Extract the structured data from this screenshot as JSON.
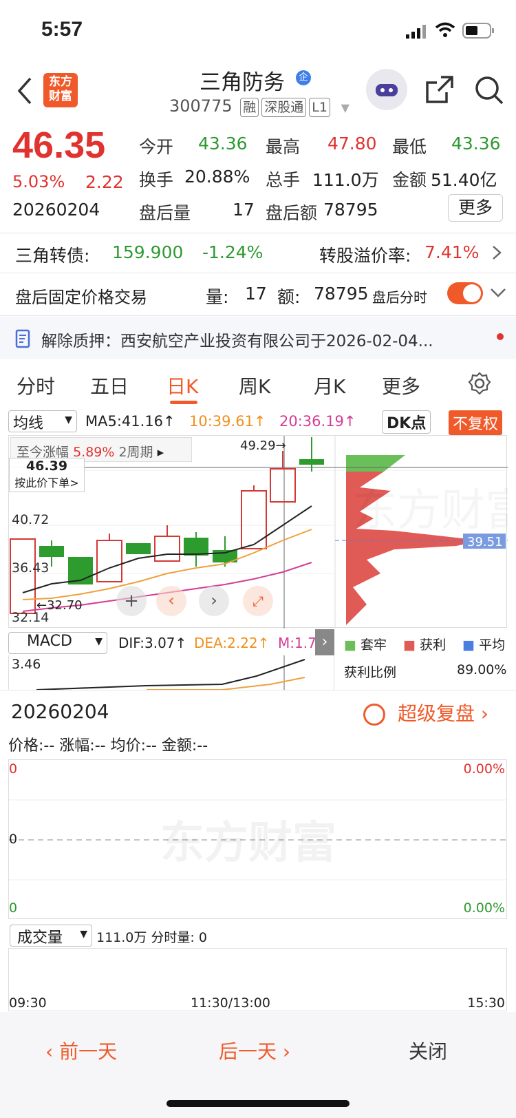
{
  "status": {
    "time": "5:57"
  },
  "header": {
    "logo_text_1": "东方",
    "logo_text_2": "财富",
    "stock_name": "三角防务",
    "badge": "企",
    "code": "300775",
    "tags": [
      "融",
      "深股通",
      "L1"
    ]
  },
  "quote": {
    "price": "46.35",
    "pct": "5.03%",
    "chg": "2.22",
    "date": "20260204",
    "open_label": "今开",
    "open": "43.36",
    "high_label": "最高",
    "high": "47.80",
    "low_label": "最低",
    "low": "43.36",
    "turnover_label": "换手",
    "turnover": "20.88%",
    "vol_label": "总手",
    "vol": "111.0万",
    "amount_label": "金额",
    "amount": "51.40亿",
    "after_vol_label": "盘后量",
    "after_vol": "17",
    "after_amt_label": "盘后额",
    "after_amt": "78795",
    "more_btn": "更多"
  },
  "bond": {
    "label": "三角转债:",
    "price": "159.900",
    "pct": "-1.24%",
    "premium_label": "转股溢价率:",
    "premium": "7.41%"
  },
  "after_trade": {
    "label": "盘后固定价格交易",
    "vol_label": "量:",
    "vol": "17",
    "amt_label": "额:",
    "amt": "78795",
    "switch_label": "盘后分时"
  },
  "notice": {
    "text": "解除质押：西安航空产业投资有限公司于2026-02-04..."
  },
  "tabs": [
    "分时",
    "五日",
    "日K",
    "周K",
    "月K",
    "更多"
  ],
  "ma": {
    "select": "均线",
    "ma5": "MA5:41.16↑",
    "ma10": "10:39.61↑",
    "ma20": "20:36.19↑",
    "dk": "DK点",
    "fq": "不复权"
  },
  "kline": {
    "since_label": "至今涨幅",
    "since_val": "5.89%",
    "period": "2周期",
    "hover_price": "46.39",
    "hover_action": "按此价下单>",
    "y_labels": [
      "40.72",
      "36.43",
      "32.14"
    ],
    "max_label": "49.29→",
    "min_label": "←32.70",
    "cost_price": "39.51",
    "legend": [
      "套牢",
      "获利",
      "平均"
    ],
    "profit_label": "获利比例",
    "profit_val": "89.00%"
  },
  "macd": {
    "select": "MACD",
    "dif": "DIF:3.07↑",
    "dea": "DEA:2.22↑",
    "m": "M:1.7...",
    "top": "3.46"
  },
  "detail": {
    "date": "20260204",
    "review": "超级复盘",
    "info": "价格:-- 涨幅:-- 均价:-- 金额:--",
    "left_top": "0",
    "right_top": "0.00%",
    "left_mid": "0",
    "left_bot": "0",
    "right_bot": "0.00%",
    "vol_select": "成交量",
    "vol_info": "111.0万 分时量: 0",
    "times": [
      "09:30",
      "11:30/13:00",
      "15:30"
    ],
    "watermark": "东方财富"
  },
  "footer": {
    "prev": "前一天",
    "next": "后一天",
    "close": "关闭"
  }
}
